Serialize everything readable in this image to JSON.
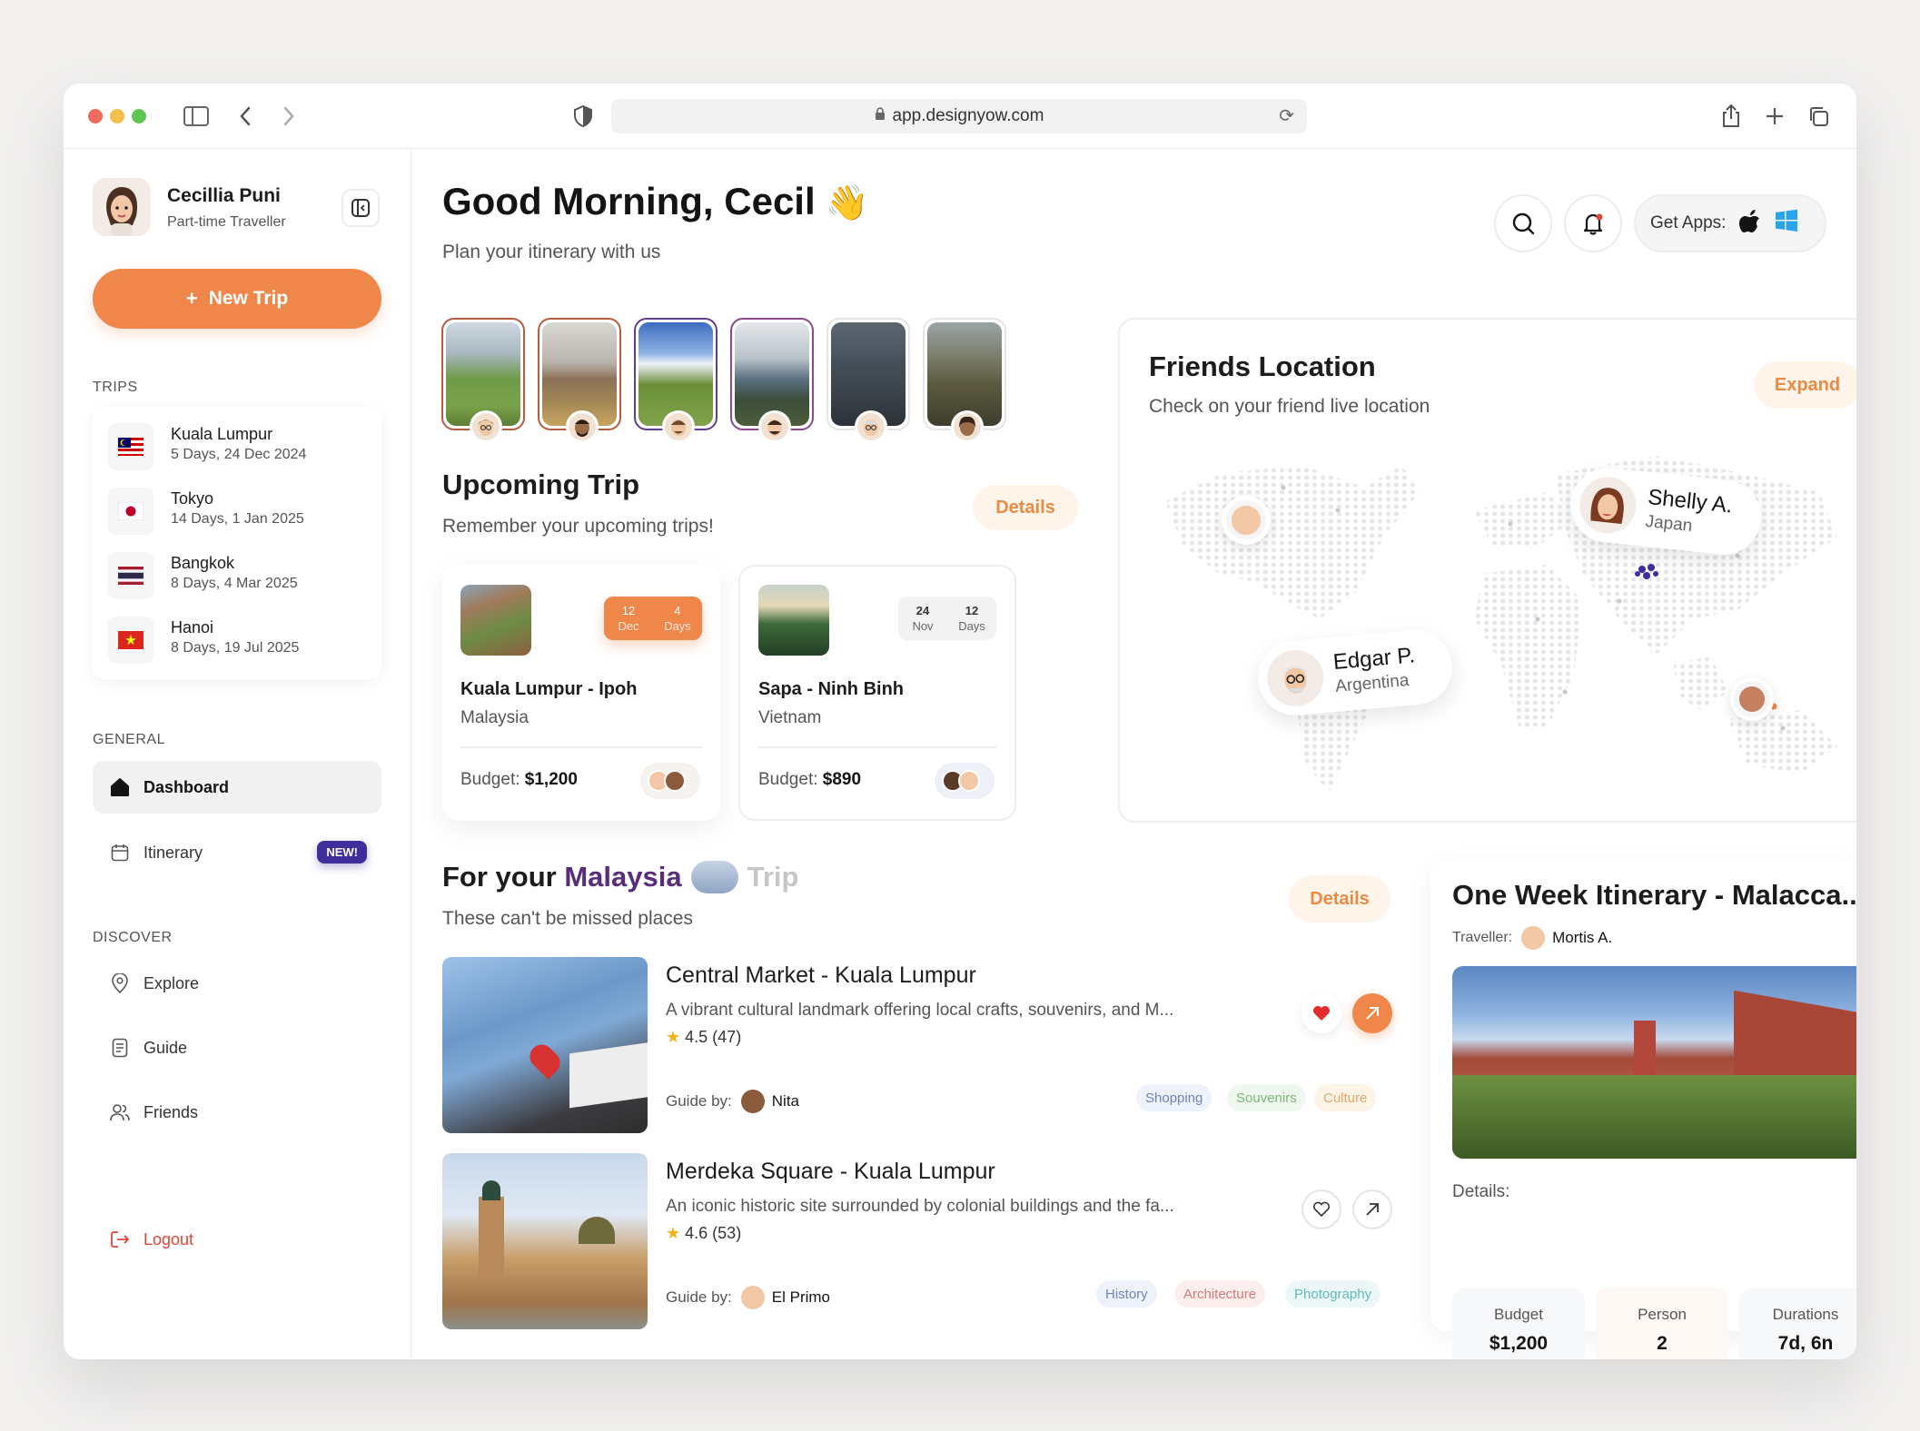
{
  "browser": {
    "url": "app.designyow.com"
  },
  "profile": {
    "name": "Cecillia Puni",
    "role": "Part-time Traveller"
  },
  "sidebar": {
    "new_trip": "New Trip",
    "trips_label": "TRIPS",
    "trips": [
      {
        "name": "Kuala Lumpur",
        "detail": "5 Days, 24 Dec 2024",
        "flag": "malaysia-flag"
      },
      {
        "name": "Tokyo",
        "detail": "14 Days, 1 Jan 2025",
        "flag": "japan-flag"
      },
      {
        "name": "Bangkok",
        "detail": "8 Days, 4 Mar 2025",
        "flag": "thailand-flag"
      },
      {
        "name": "Hanoi",
        "detail": "8 Days, 19 Jul 2025",
        "flag": "vietnam-flag"
      }
    ],
    "general_label": "GENERAL",
    "dashboard": "Dashboard",
    "itinerary": "Itinerary",
    "new_badge": "NEW!",
    "discover_label": "DISCOVER",
    "explore": "Explore",
    "guide": "Guide",
    "friends": "Friends",
    "logout": "Logout"
  },
  "header": {
    "greeting": "Good Morning, Cecil",
    "wave": "👋",
    "subtitle": "Plan your itinerary with us",
    "get_apps": "Get Apps:"
  },
  "upcoming": {
    "title": "Upcoming Trip",
    "subtitle": "Remember your upcoming trips!",
    "details": "Details",
    "trips": [
      {
        "name": "Kuala Lumpur - Ipoh",
        "country": "Malaysia",
        "budget_label": "Budget:",
        "budget": "$1,200",
        "date_num": "12",
        "date_mon": "Dec",
        "days_num": "4",
        "days_lbl": "Days"
      },
      {
        "name": "Sapa - Ninh Binh",
        "country": "Vietnam",
        "budget_label": "Budget:",
        "budget": "$890",
        "date_num": "24",
        "date_mon": "Nov",
        "days_num": "12",
        "days_lbl": "Days"
      }
    ]
  },
  "friends": {
    "title": "Friends Location",
    "subtitle": "Check on your friend live location",
    "expand": "Expand",
    "pins": [
      {
        "name": "Shelly A.",
        "place": "Japan"
      },
      {
        "name": "Edgar P.",
        "place": "Argentina"
      }
    ]
  },
  "malaysia": {
    "t1": "For your",
    "t2": "Malaysia",
    "t3": "Trip",
    "subtitle": "These can't be missed places",
    "details": "Details",
    "places": [
      {
        "title": "Central Market - Kuala Lumpur",
        "desc": "A vibrant cultural landmark offering local crafts, souvenirs, and M...",
        "rating": "4.5 (47)",
        "guide_label": "Guide by:",
        "guide": "Nita",
        "tags": [
          "Shopping",
          "Souvenirs",
          "Culture"
        ],
        "liked": true
      },
      {
        "title": "Merdeka Square - Kuala Lumpur",
        "desc": "An iconic historic site surrounded by colonial buildings and the fa...",
        "rating": "4.6 (53)",
        "guide_label": "Guide by:",
        "guide": "El Primo",
        "tags": [
          "History",
          "Architecture",
          "Photography"
        ],
        "liked": false
      }
    ]
  },
  "itinerary": {
    "title": "One Week Itinerary - Malacca...",
    "traveller_label": "Traveller:",
    "traveller": "Mortis A.",
    "details_label": "Details:",
    "stats": [
      {
        "label": "Budget",
        "value": "$1,200"
      },
      {
        "label": "Person",
        "value": "2"
      },
      {
        "label": "Durations",
        "value": "7d, 6n"
      }
    ]
  },
  "colors": {
    "accent": "#f0874a",
    "purple": "#3f2e9c",
    "dashboard_bg": "#f1f1f1"
  }
}
